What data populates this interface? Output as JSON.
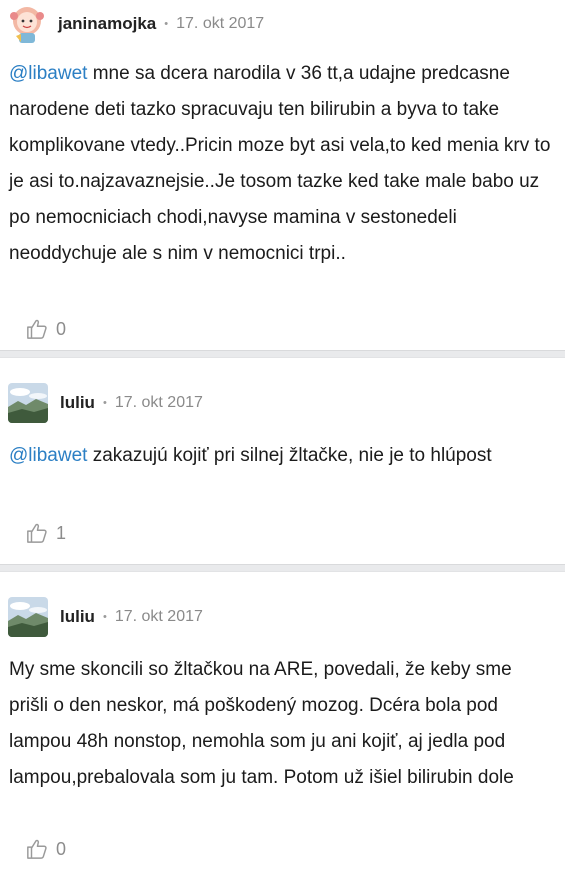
{
  "comments": [
    {
      "author": "janinamojka",
      "separator": "•",
      "date": "17. okt 2017",
      "mention": "@libawet",
      "text": " mne sa dcera narodila v 36 tt,a udajne predcasne narodene deti tazko spracuvaju ten bilirubin a byva to take komplikovane vtedy..Pricin moze byt asi vela,to ked menia krv to je asi to.najzavaznejsie..Je tosom tazke ked take male babo uz po nemocniciach chodi,navyse mamina v sestonedeli neoddychuje ale s nim v nemocnici trpi..",
      "likes": "0",
      "avatar_icon": "cartoon-girl-avatar"
    },
    {
      "author": "luliu",
      "separator": "•",
      "date": "17. okt 2017",
      "mention": "@libawet",
      "text": " zakazujú kojiť pri silnej žltačke, nie je to hlúpost",
      "likes": "1",
      "avatar_icon": "landscape-photo-avatar"
    },
    {
      "author": "luliu",
      "separator": "•",
      "date": "17. okt 2017",
      "mention": "",
      "text": "My sme skoncili so žltačkou na ARE, povedali, že keby sme prišli o den neskor, má poškodený mozog. Dcéra bola pod lampou 48h nonstop, nemohla som ju ani kojiť, aj jedla pod lampou,prebalovala som ju tam. Potom už išiel bilirubin dole",
      "likes": "0",
      "avatar_icon": "landscape-photo-avatar"
    }
  ],
  "colors": {
    "mention": "#2b7fc4",
    "meta": "#8a8a8a",
    "separator_band": "#e9eaec"
  }
}
